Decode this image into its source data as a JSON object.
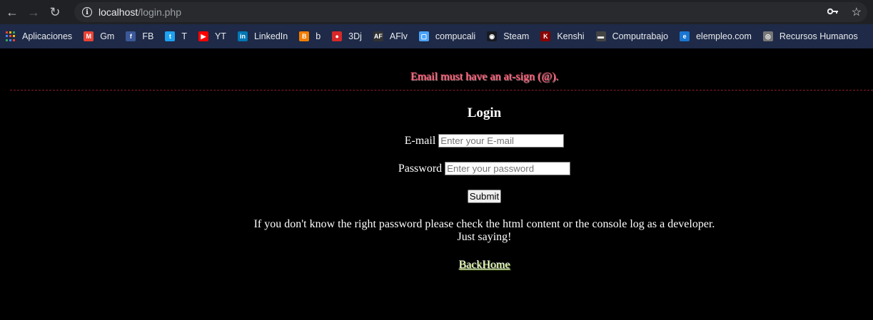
{
  "browser": {
    "url_host": "localhost",
    "url_path": "/login.php",
    "icons": {
      "back": "arrow-left-icon",
      "forward": "arrow-right-icon",
      "reload": "reload-icon",
      "site_info": "info-icon",
      "key": "key-icon",
      "star": "star-icon"
    }
  },
  "bookmarks": [
    {
      "label": "Aplicaciones",
      "icon": "apps-grid-icon"
    },
    {
      "label": "Gm",
      "icon": "gmail-icon",
      "color": "#ea4335"
    },
    {
      "label": "FB",
      "icon": "facebook-icon",
      "color": "#3b5998"
    },
    {
      "label": "T",
      "icon": "twitter-icon",
      "color": "#1da1f2"
    },
    {
      "label": "YT",
      "icon": "youtube-icon",
      "color": "#ff0000"
    },
    {
      "label": "LinkedIn",
      "icon": "linkedin-icon",
      "color": "#0077b5"
    },
    {
      "label": "b",
      "icon": "blogger-icon",
      "color": "#f57d00"
    },
    {
      "label": "3Dj",
      "icon": "3dj-icon",
      "color": "#d62828"
    },
    {
      "label": "AFlv",
      "icon": "aflv-icon",
      "color": "#333333"
    },
    {
      "label": "compucali",
      "icon": "tv-icon",
      "color": "#4aa3ff"
    },
    {
      "label": "Steam",
      "icon": "steam-icon",
      "color": "#171a21"
    },
    {
      "label": "Kenshi",
      "icon": "kenshi-icon",
      "color": "#8b0000"
    },
    {
      "label": "Computrabajo",
      "icon": "computrabajo-icon",
      "color": "#444444"
    },
    {
      "label": "elempleo.com",
      "icon": "elempleo-icon",
      "color": "#1976d2"
    },
    {
      "label": "Recursos Humanos",
      "icon": "rh-icon",
      "color": "#777777"
    }
  ],
  "page": {
    "error_message": "Email must have an at-sign (@).",
    "title": "Login",
    "email_label": "E-mail",
    "email_placeholder": "Enter your E-mail",
    "email_value": "",
    "password_label": "Password",
    "password_placeholder": "Enter your password",
    "password_value": "",
    "submit_label": "Submit",
    "hint_line1": "If you don't know the right password please check the html content or the console log as a developer.",
    "hint_line2": "Just saying!",
    "back_link": "BackHome"
  },
  "colors": {
    "error": "#ff4d6a",
    "background": "#000000",
    "bookmarks_bar": "#1e2a47"
  }
}
